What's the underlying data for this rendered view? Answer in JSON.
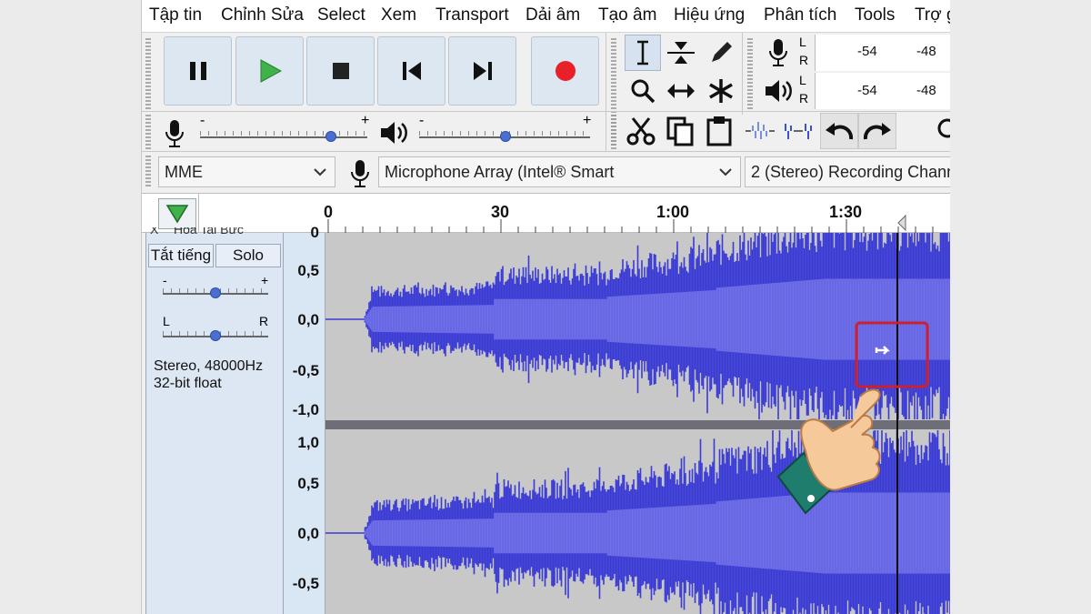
{
  "menu": [
    "Tập tin",
    "Chỉnh Sửa",
    "Select",
    "Xem",
    "Transport",
    "Dải âm",
    "Tạo âm",
    "Hiệu ứng",
    "Phân tích",
    "Tools",
    "Trợ g"
  ],
  "transport": {
    "buttons": [
      {
        "name": "pause-button",
        "icon": "pause-icon"
      },
      {
        "name": "play-button",
        "icon": "play-icon"
      },
      {
        "name": "stop-button",
        "icon": "stop-icon"
      },
      {
        "name": "skip-to-start-button",
        "icon": "skip-start-icon"
      },
      {
        "name": "skip-to-end-button",
        "icon": "skip-end-icon"
      },
      {
        "name": "record-button",
        "icon": "record-icon"
      }
    ]
  },
  "meters": {
    "channel_l": "L",
    "channel_r": "R",
    "record_ticks": [
      "-54",
      "-48"
    ],
    "play_ticks": [
      "-54",
      "-48"
    ]
  },
  "mixer": {
    "rec_minus": "-",
    "rec_plus": "+",
    "play_minus": "-",
    "play_plus": "+"
  },
  "device": {
    "host": "MME",
    "input": "Microphone Array (Intel® Smart",
    "channels": "2 (Stereo) Recording Chann"
  },
  "ruler": {
    "ticks": [
      "0",
      "30",
      "1:00",
      "1:30"
    ]
  },
  "track": {
    "name": "Hòa Tai Bức",
    "mute": "Tắt tiếng",
    "solo": "Solo",
    "gain_minus": "-",
    "gain_plus": "+",
    "pan_left": "L",
    "pan_right": "R",
    "format_line1": "Stereo, 48000Hz",
    "format_line2": "32-bit float",
    "close": "X"
  },
  "scale_top": [
    "0",
    "0,5",
    "0,0",
    "-0,5",
    "-1,0"
  ],
  "scale_bottom": [
    "1,0",
    "0,5",
    "0,0",
    "-0,5"
  ],
  "colors": {
    "waveform": "#3a3ad6",
    "waveform_rms": "#6f6fe8",
    "selection_box": "#cc1f2f",
    "record_red": "#e8202a",
    "play_green": "#3fb24a"
  }
}
